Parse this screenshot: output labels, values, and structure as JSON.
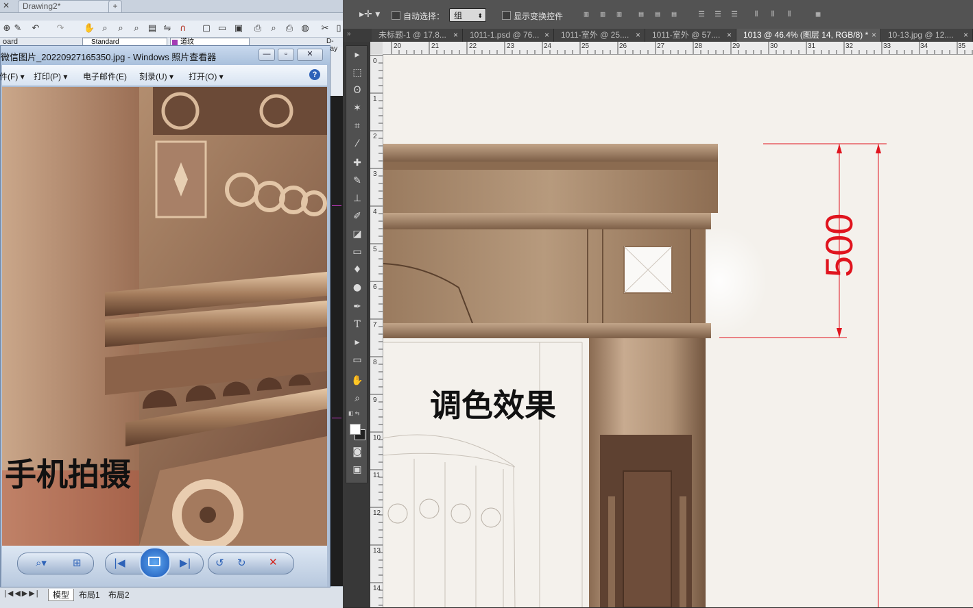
{
  "cad": {
    "tab_title": "Drawing2*",
    "style_field": "Standard",
    "layer_field": "道纹",
    "side_label": "D-Lay",
    "layout_tabs": [
      "模型",
      "布局1",
      "布局2"
    ]
  },
  "viewer": {
    "title": "微信图片_20220927165350.jpg - Windows 照片查看器",
    "menu": [
      "件(F)",
      "打印(P)",
      "电子邮件(E)",
      "刻录(U)",
      "打开(O)"
    ],
    "overlay_text": "手机拍摄"
  },
  "photoshop": {
    "options": {
      "auto_select_label": "自动选择：",
      "auto_select_value": "组",
      "show_transform_label": "显示变换控件"
    },
    "tabs": [
      {
        "label": "未标题-1 @ 17.8..."
      },
      {
        "label": "1011-1.psd @ 76..."
      },
      {
        "label": "1011-室外 @ 25...."
      },
      {
        "label": "1011-室外 @ 57...."
      },
      {
        "label": "1013 @ 46.4% (图层 14, RGB/8) *",
        "active": true
      },
      {
        "label": "10-13.jpg @ 12...."
      }
    ],
    "ruler_top": [
      "20",
      "21",
      "22",
      "23",
      "24",
      "25",
      "26",
      "27",
      "28",
      "29",
      "30",
      "31",
      "32",
      "33",
      "34",
      "35"
    ],
    "ruler_left": [
      "0",
      "1",
      "2",
      "3",
      "4",
      "5",
      "6",
      "7",
      "8",
      "9",
      "10",
      "11",
      "12",
      "13",
      "14"
    ],
    "canvas": {
      "dimension_value": "500",
      "overlay_text": "调色效果"
    }
  },
  "colors": {
    "ps_bg": "#383838",
    "bronze": "#a88a6d",
    "dimension_red": "#e0141e",
    "viewer_chrome": "#b7c8de"
  }
}
